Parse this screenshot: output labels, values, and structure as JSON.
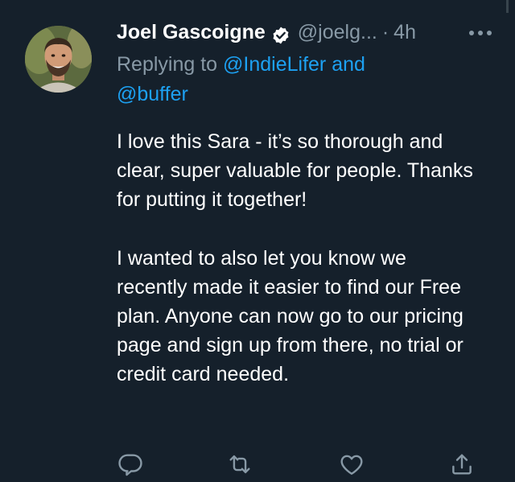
{
  "tweet": {
    "display_name": "Joel Gascoigne",
    "verified_icon": "verified-badge-icon",
    "handle": "@joelg...",
    "separator": "·",
    "time": "4h",
    "more_icon": "more-horizontal-icon",
    "reply_prefix": "Replying to ",
    "reply_mention_1": "@IndieLifer",
    "reply_and": " and ",
    "reply_mention_2": "@buffer",
    "body_paragraph_1": "I love this Sara - it’s so thorough and clear, super valuable for people. Thanks for putting it together!",
    "body_paragraph_2": "I wanted to also let you know we recently made it easier to find our Free plan. Anyone can now go to our pricing page and sign up from there, no trial or credit card needed."
  },
  "actions": [
    {
      "name": "reply-icon"
    },
    {
      "name": "retweet-icon"
    },
    {
      "name": "like-icon"
    },
    {
      "name": "share-icon"
    }
  ],
  "colors": {
    "background": "#15202b",
    "text_primary": "#ffffff",
    "text_secondary": "#8899a6",
    "accent_blue": "#1da1f2",
    "icon_gray": "#8899a6"
  }
}
